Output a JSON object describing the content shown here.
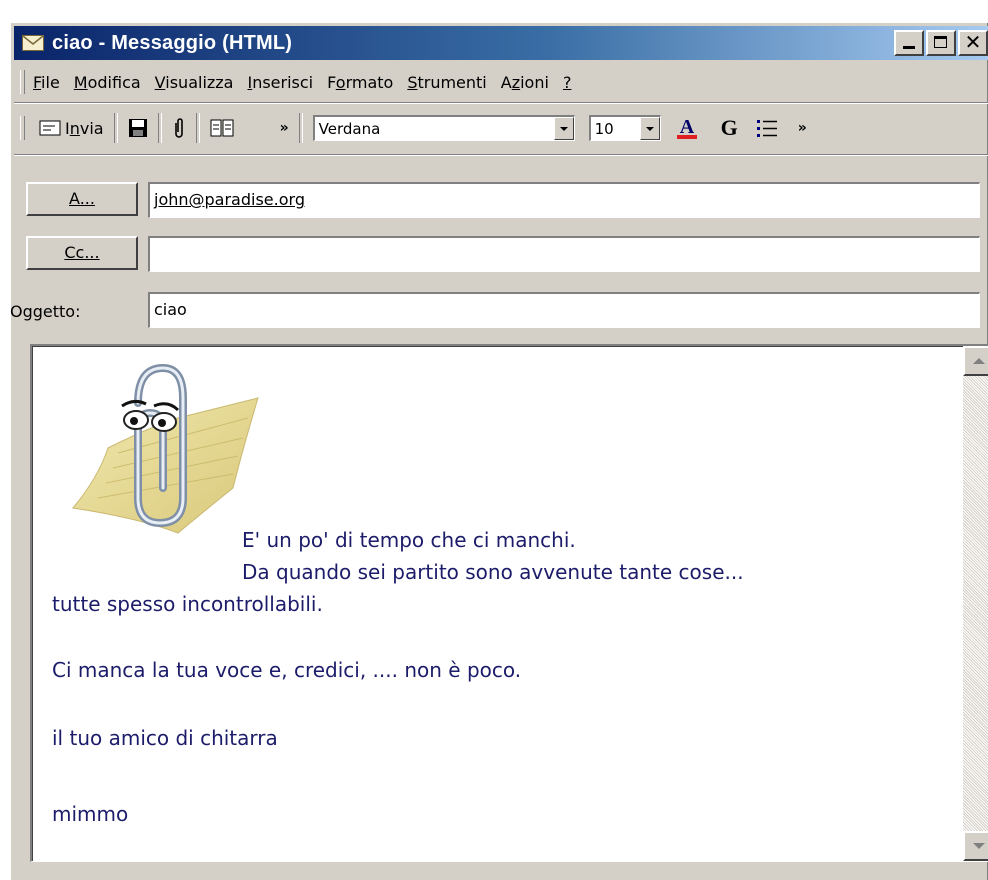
{
  "window": {
    "title": "ciao - Messaggio (HTML)",
    "close_glyph": "✕"
  },
  "menu": {
    "items": [
      {
        "label_u": "F",
        "label_rest": "ile"
      },
      {
        "label_u": "M",
        "label_rest": "odifica"
      },
      {
        "label_u": "V",
        "label_rest": "isualizza"
      },
      {
        "label_u": "I",
        "label_rest": "nserisci"
      },
      {
        "label_pre": "F",
        "label_u": "o",
        "label_rest": "rmato"
      },
      {
        "label_u": "S",
        "label_rest": "trumenti"
      },
      {
        "label_pre": "A",
        "label_u": "z",
        "label_rest": "ioni"
      },
      {
        "label_u": "?",
        "label_rest": ""
      }
    ]
  },
  "toolbar": {
    "send_pre": "I",
    "send_u": "n",
    "send_rest": "via",
    "font_name": "Verdana",
    "font_size": "10",
    "bold_label": "G",
    "chevron": "»"
  },
  "fields": {
    "to_button": "A...",
    "to_value": "john@paradise.org",
    "cc_button": "Cc...",
    "cc_value": "",
    "subject_label": "Oggetto:",
    "subject_value": "ciao"
  },
  "body": {
    "lines": [
      "E' un po' di tempo che ci manchi.",
      "Da quando sei partito sono avvenute tante cose...",
      "tutte spesso incontrollabili.",
      "Ci manca la tua voce e, credici, .... non è poco.",
      "il tuo amico di chitarra",
      "mimmo"
    ]
  },
  "colors": {
    "title_gradient_start": "#0a246a",
    "title_gradient_end": "#a6caf0",
    "body_text": "#1c1c6a",
    "chrome": "#d4d0c8"
  }
}
